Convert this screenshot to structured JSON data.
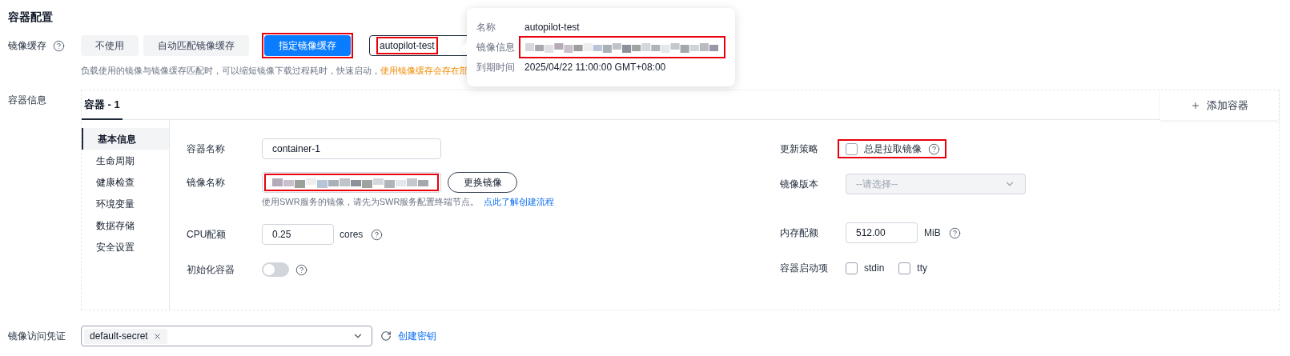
{
  "section_title": "容器配置",
  "image_cache": {
    "label": "镜像缓存",
    "options": [
      {
        "label": "不使用",
        "selected": false,
        "highlighted": false
      },
      {
        "label": "自动匹配镜像缓存",
        "selected": false,
        "highlighted": false
      },
      {
        "label": "指定镜像缓存",
        "selected": true,
        "highlighted": true
      }
    ],
    "value": "autopilot-test",
    "value_highlighted": true,
    "hint": "负载使用的镜像与镜像缓存匹配时，可以缩短镜像下载过程耗时，快速启动，",
    "warning": "使用镜像缓存会存在部"
  },
  "popover": {
    "rows": [
      {
        "label": "名称",
        "kind": "text",
        "value": "autopilot-test"
      },
      {
        "label": "镜像信息",
        "kind": "blurred",
        "highlighted": true
      },
      {
        "label": "到期时间",
        "kind": "text",
        "value": "2025/04/22 11:00:00 GMT+08:00"
      }
    ]
  },
  "container_info": {
    "label": "容器信息",
    "tabs": [
      {
        "label": "容器 - 1",
        "selected": true
      }
    ],
    "add_button": "添加容器",
    "side_menu": [
      {
        "label": "基本信息",
        "selected": true
      },
      {
        "label": "生命周期",
        "selected": false
      },
      {
        "label": "健康检查",
        "selected": false
      },
      {
        "label": "环境变量",
        "selected": false
      },
      {
        "label": "数据存储",
        "selected": false
      },
      {
        "label": "安全设置",
        "selected": false
      }
    ],
    "left_fields": [
      {
        "kind": "input",
        "label": "容器名称",
        "value": "container-1"
      },
      {
        "kind": "image",
        "label": "镜像名称",
        "highlighted": true,
        "button": "更换镜像",
        "hint": "使用SWR服务的镜像，请先为SWR服务配置终端节点。",
        "link": "点此了解创建流程"
      },
      {
        "kind": "number",
        "label": "CPU配额",
        "value": "0.25",
        "unit": "cores",
        "help": true
      },
      {
        "kind": "toggle",
        "label": "初始化容器",
        "on": false,
        "help": true
      }
    ],
    "right_fields": [
      {
        "kind": "checkbox",
        "label": "更新策略",
        "highlighted": true,
        "options": [
          {
            "label": "总是拉取镜像",
            "checked": false
          }
        ],
        "help": true
      },
      {
        "kind": "select",
        "label": "镜像版本",
        "placeholder": "--请选择--",
        "disabled": true
      },
      {
        "kind": "number",
        "label": "内存配额",
        "value": "512.00",
        "unit": "MiB",
        "help": true
      },
      {
        "kind": "checkbox",
        "label": "容器启动项",
        "options": [
          {
            "label": "stdin",
            "checked": false
          },
          {
            "label": "tty",
            "checked": false
          }
        ]
      }
    ]
  },
  "credential": {
    "label": "镜像访问凭证",
    "tags": [
      "default-secret"
    ],
    "link": "创建密钥"
  }
}
